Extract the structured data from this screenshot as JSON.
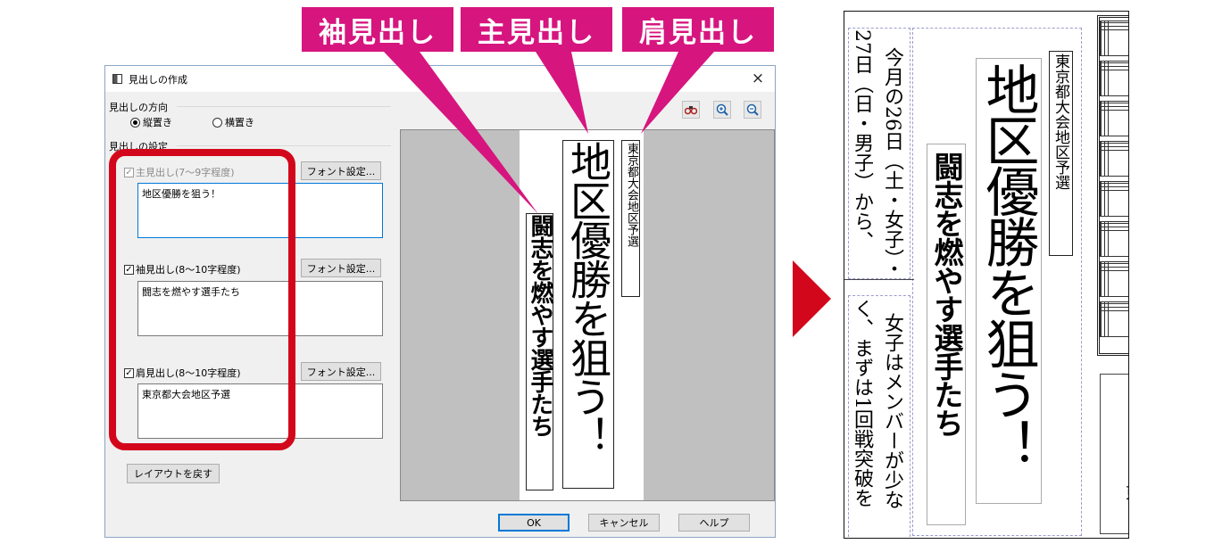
{
  "callouts": {
    "sode": "袖見出し",
    "shu": "主見出し",
    "kata": "肩見出し"
  },
  "dialog": {
    "title": "見出しの作成",
    "close": "×",
    "direction_label": "見出しの方向",
    "radio_vertical": "縦置き",
    "radio_horizontal": "横置き",
    "settings_label": "見出しの設定",
    "main": {
      "label": "主見出し(7～9字程度)",
      "value": "地区優勝を狙う！",
      "check": "✓"
    },
    "sode": {
      "label": "袖見出し(8～10字程度)",
      "value": "闘志を燃やす選手たち",
      "check": "✓"
    },
    "kata": {
      "label": "肩見出し(8～10字程度)",
      "value": "東京都大会地区予選",
      "check": "✓"
    },
    "font_button": "フォント設定...",
    "reset_button": "レイアウトを戻す",
    "ok": "OK",
    "cancel": "キャンセル",
    "help": "ヘルプ",
    "tools": {
      "binoculars": "binoculars-icon",
      "zoom_in": "zoom-in-icon",
      "zoom_out": "zoom-out-icon"
    }
  },
  "preview": {
    "main_text": "地区優勝を狙う！",
    "sode_text": "闘志を燃やす選手たち",
    "kata_text": "東京都大会地区予選"
  },
  "result": {
    "col1": "27日（日・男子）から、",
    "col2": "今月の26日（土・女子）・",
    "col3": "く、まずは1回戦突破を",
    "col4": "女子はメンバーが少な",
    "main_text": "地区優勝を狙う！",
    "sode_text": "闘志を燃やす選手たち",
    "kata_text": "東京都大会地区予選",
    "edge_char": "東"
  },
  "colors": {
    "accent": "#d6157f",
    "highlight": "#d3071b",
    "arrow": "#d3071b"
  }
}
